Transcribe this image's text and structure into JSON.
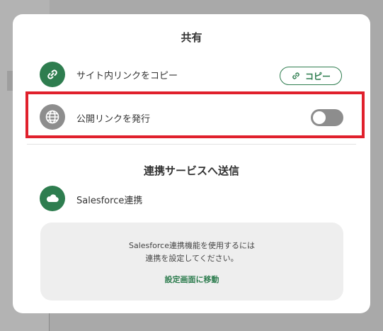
{
  "modal": {
    "title": "共有"
  },
  "site_link": {
    "label": "サイト内リンクをコピー",
    "copy_button_label": "コピー"
  },
  "public_link": {
    "label": "公開リンクを発行",
    "toggle_on": false
  },
  "integration": {
    "section_title": "連携サービスへ送信",
    "salesforce_label": "Salesforce連携",
    "notice_line1": "Salesforce連携機能を使用するには",
    "notice_line2": "連携を設定してください。",
    "settings_link": "設定画面に移動"
  },
  "icons": {
    "site_link": "link-icon",
    "copy": "link-icon",
    "public_link": "globe-icon",
    "salesforce": "cloud-icon"
  },
  "colors": {
    "accent_green": "#2e7d4f",
    "highlight_red": "#e0202c",
    "toggle_off": "#8d8d8d"
  }
}
